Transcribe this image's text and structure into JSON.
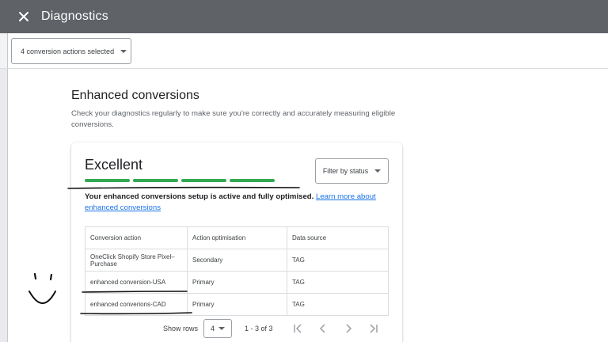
{
  "topbar": {
    "title": "Diagnostics",
    "close_icon": "close-icon"
  },
  "selector": {
    "label": "4 conversion actions selected"
  },
  "section": {
    "title": "Enhanced conversions",
    "description": "Check your diagnostics regularly to make sure you're correctly and accurately measuring eligible conversions."
  },
  "card": {
    "status": "Excellent",
    "status_level": {
      "filled_segments": 4,
      "total_segments": 4
    },
    "filter_label": "Filter by status",
    "message": "Your enhanced conversions setup is active and fully optimised.",
    "learn_more": "Learn more about enhanced conversions",
    "table": {
      "headers": [
        "Conversion action",
        "Action optimisation",
        "Data source"
      ],
      "rows": [
        {
          "action": "OneClick Shopify Store Pixel–Purchase",
          "optimisation": "Secondary",
          "source": "TAG"
        },
        {
          "action": "enhanced conversion-USA",
          "optimisation": "Primary",
          "source": "TAG"
        },
        {
          "action": "enhanced converions-CAD",
          "optimisation": "Primary",
          "source": "TAG"
        }
      ]
    },
    "pagination": {
      "show_rows_label": "Show rows",
      "rows_value": "4",
      "range": "1 - 3 of 3"
    }
  },
  "colors": {
    "topbar": "#5f6368",
    "status_green": "#34a853",
    "link": "#1a73e8"
  }
}
